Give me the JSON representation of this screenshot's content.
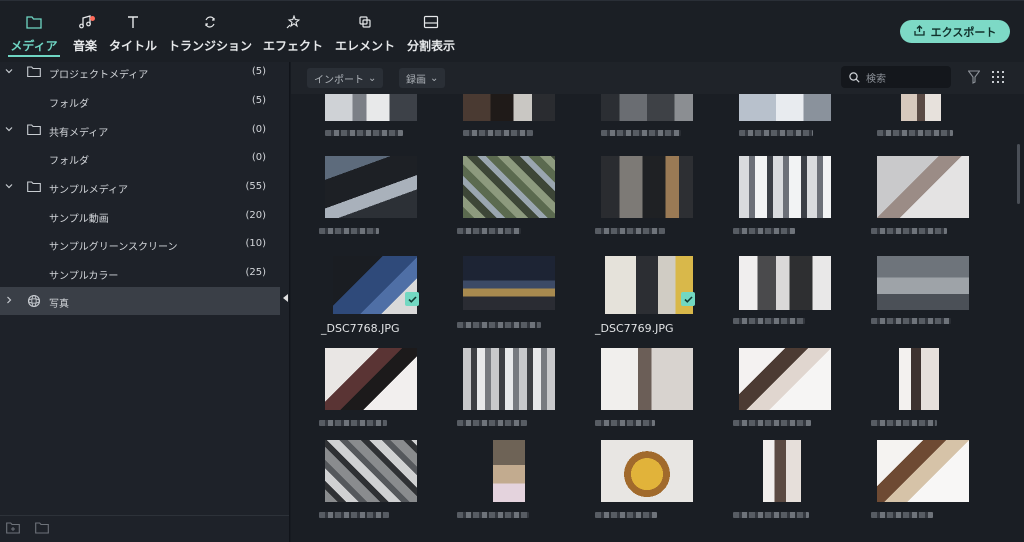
{
  "toolbar": {
    "tabs": [
      {
        "label": "メディア",
        "icon": "folder-icon",
        "active": true
      },
      {
        "label": "音楽",
        "icon": "music-note-icon",
        "badge": true
      },
      {
        "label": "タイトル",
        "icon": "text-t-icon"
      },
      {
        "label": "トランジション",
        "icon": "transition-icon"
      },
      {
        "label": "エフェクト",
        "icon": "effect-star-icon"
      },
      {
        "label": "エレメント",
        "icon": "element-layers-icon"
      },
      {
        "label": "分割表示",
        "icon": "split-screen-icon"
      }
    ],
    "export_label": "エクスポート",
    "accent": "#6fd6c4"
  },
  "sidebar": {
    "items": [
      {
        "label": "プロジェクトメディア",
        "count": "(5)",
        "level": 0,
        "expanded": true
      },
      {
        "label": "フォルダ",
        "count": "(5)",
        "level": 1
      },
      {
        "label": "共有メディア",
        "count": "(0)",
        "level": 0,
        "expanded": true
      },
      {
        "label": "フォルダ",
        "count": "(0)",
        "level": 1
      },
      {
        "label": "サンプルメディア",
        "count": "(55)",
        "level": 0,
        "expanded": true
      },
      {
        "label": "サンプル動画",
        "count": "(20)",
        "level": 1
      },
      {
        "label": "サンプルグリーンスクリーン",
        "count": "(10)",
        "level": 1
      },
      {
        "label": "サンプルカラー",
        "count": "(25)",
        "level": 1
      },
      {
        "label": "写真",
        "count": "",
        "level": 0,
        "expanded": false,
        "selected": true
      }
    ]
  },
  "main": {
    "import_label": "インポート",
    "record_label": "録画",
    "search_placeholder": "検索",
    "files": [
      {
        "name": "_DSC7768.JPG",
        "checked": true
      },
      {
        "name": "_DSC7769.JPG",
        "checked": true
      }
    ]
  }
}
